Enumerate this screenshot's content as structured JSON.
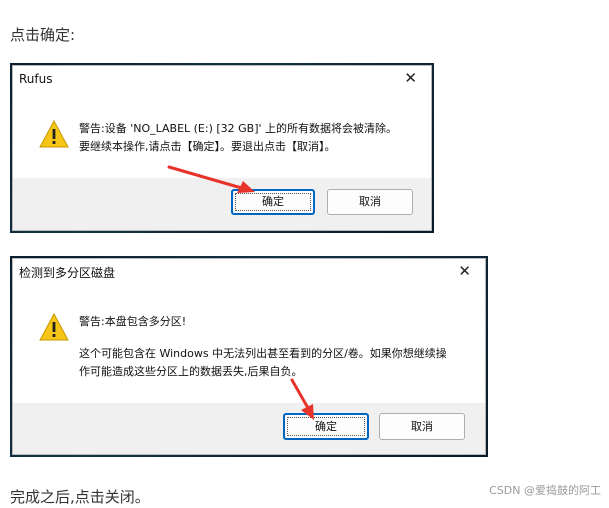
{
  "intro_text": "点击确定:",
  "outro_text": "完成之后,点击关闭。",
  "watermark": "CSDN @爱捣鼓的阿工",
  "dialog1": {
    "title": "Rufus",
    "close_glyph": "✕",
    "icon": "warning-icon",
    "line1": "警告:设备 'NO_LABEL (E:) [32 GB]' 上的所有数据将会被清除。",
    "line2": "要继续本操作,请点击【确定】。要退出点击【取消】。",
    "ok_label": "确定",
    "cancel_label": "取消"
  },
  "dialog2": {
    "title": "检测到多分区磁盘",
    "close_glyph": "✕",
    "icon": "warning-icon",
    "line1": "警告:本盘包含多分区!",
    "line2": "这个可能包含在 Windows 中无法列出甚至看到的分区/卷。如果你想继续操",
    "line3": "作可能造成这些分区上的数据丢失,后果自负。",
    "ok_label": "确定",
    "cancel_label": "取消"
  },
  "colors": {
    "accent": "#0067c0",
    "arrow": "#e8332a",
    "warning_fill": "#f5c518"
  }
}
